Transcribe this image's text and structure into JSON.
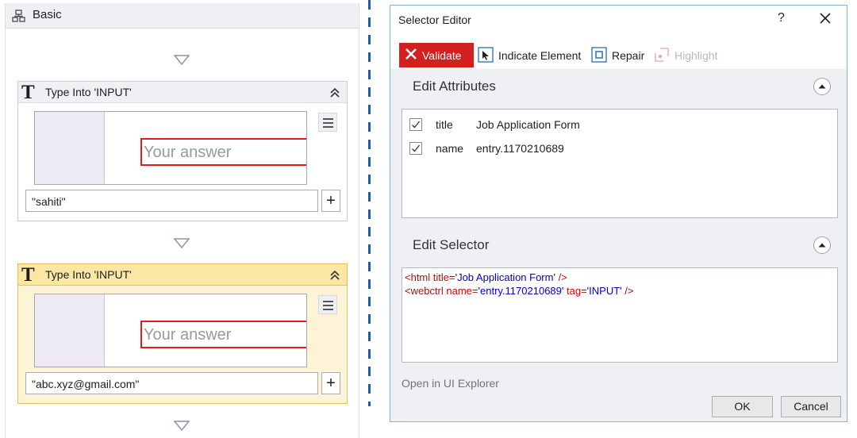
{
  "workflow": {
    "sequence_title": "Basic",
    "activities": [
      {
        "title": "Type Into 'INPUT'",
        "preview_placeholder": "Your answer",
        "text_value": "\"sahiti\"",
        "selected": false
      },
      {
        "title": "Type Into 'INPUT'",
        "preview_placeholder": "Your answer",
        "text_value": "\"abc.xyz@gmail.com\"",
        "selected": true
      }
    ],
    "plus_label": "+",
    "activity_icon_letter": "T"
  },
  "dialog": {
    "title": "Selector Editor",
    "help_label": "?",
    "toolbar": {
      "validate": "Validate",
      "indicate": "Indicate Element",
      "repair": "Repair",
      "highlight": "Highlight"
    },
    "edit_attributes": {
      "title": "Edit Attributes",
      "rows": [
        {
          "name": "title",
          "value": "Job Application Form",
          "checked": true
        },
        {
          "name": "name",
          "value": "entry.1170210689",
          "checked": true
        }
      ]
    },
    "edit_selector": {
      "title": "Edit Selector",
      "lines": [
        {
          "open": "<html ",
          "attrs": [
            {
              "k": "title",
              "v": "'Job Application Form'"
            }
          ],
          "close": " />"
        },
        {
          "open": "<webctrl ",
          "attrs": [
            {
              "k": "name",
              "v": "'entry.1170210689'"
            },
            {
              "k": "tag",
              "v": "'INPUT'"
            }
          ],
          "close": " />"
        }
      ]
    },
    "open_in_explorer": "Open in UI Explorer",
    "ok": "OK",
    "cancel": "Cancel"
  },
  "colors": {
    "validate_bg": "#d21f1f",
    "selected_activity": "#fdf3d6",
    "divider": "#1f5d9c",
    "preview_input_border": "#e21b1b"
  }
}
